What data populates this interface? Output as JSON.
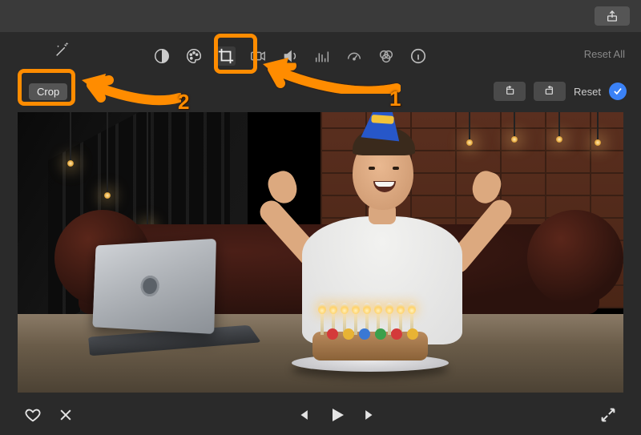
{
  "titlebar": {
    "share_tooltip": "Share"
  },
  "toolbar": {
    "reset_all_label": "Reset All",
    "icons": {
      "magic": "magic-wand-icon",
      "contrast": "half-circle-icon",
      "color": "palette-icon",
      "crop": "crop-icon",
      "stabilize": "camera-icon",
      "volume": "speaker-icon",
      "noise": "equalizer-icon",
      "speed": "speedometer-icon",
      "filter": "venn-icon",
      "info": "info-icon"
    }
  },
  "crop_row": {
    "crop_label": "Crop",
    "rotate_ccw_tooltip": "Rotate counterclockwise",
    "rotate_cw_tooltip": "Rotate clockwise",
    "reset_label": "Reset",
    "apply_tooltip": "Apply"
  },
  "controls": {
    "favorite_tooltip": "Favorite",
    "reject_tooltip": "Reject",
    "prev_tooltip": "Previous frame",
    "play_tooltip": "Play",
    "next_tooltip": "Next frame",
    "fullscreen_tooltip": "Fullscreen"
  },
  "annotations": {
    "num1": "1",
    "num2": "2"
  },
  "colors": {
    "highlight": "#ff8c00",
    "apply_blue": "#3b82f6"
  }
}
